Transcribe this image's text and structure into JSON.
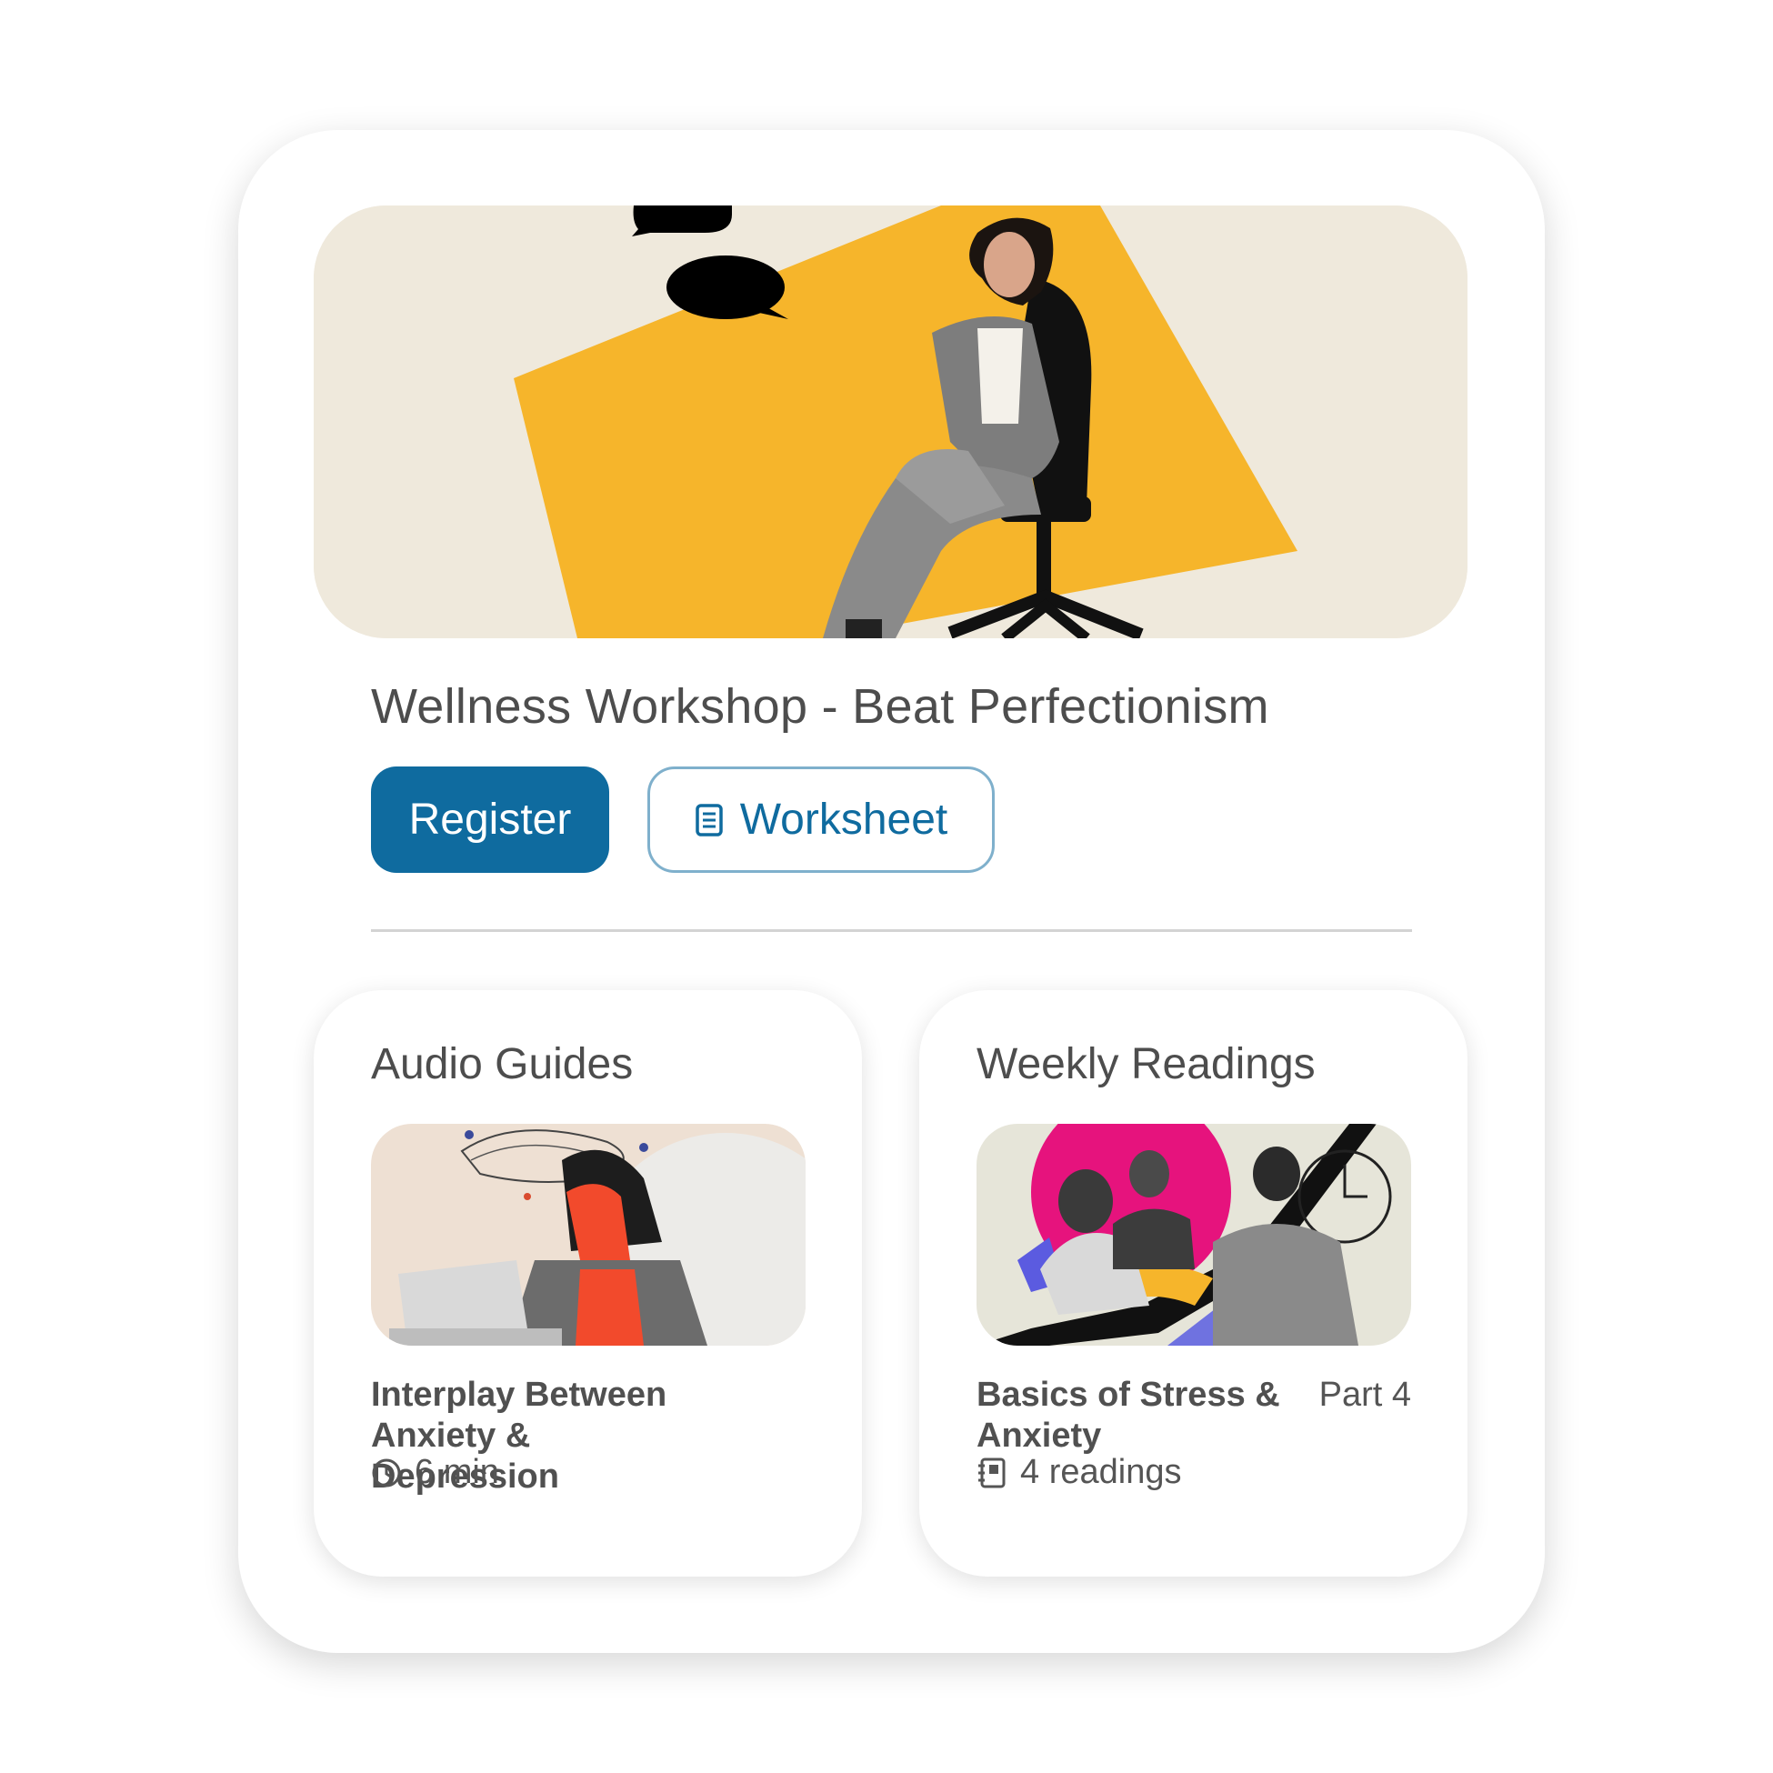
{
  "workshop": {
    "title": "Wellness Workshop - Beat Perfectionism",
    "register_label": "Register",
    "worksheet_label": "Worksheet",
    "worksheet_icon": "document-icon"
  },
  "audio": {
    "section_title": "Audio Guides",
    "item_title": "Interplay Between Anxiety & Depression",
    "duration": "6 min",
    "meta_icon": "clock-icon"
  },
  "readings": {
    "section_title": "Weekly Readings",
    "item_title": "Basics of Stress & Anxiety",
    "part": "Part 4",
    "count": "4 readings",
    "meta_icon": "book-icon"
  },
  "colors": {
    "accent": "#0f6b9f",
    "outline": "#7fb0cc",
    "text": "#4d4d4d",
    "hero_bg": "#efe9dc",
    "hero_yellow": "#f6b52b"
  }
}
